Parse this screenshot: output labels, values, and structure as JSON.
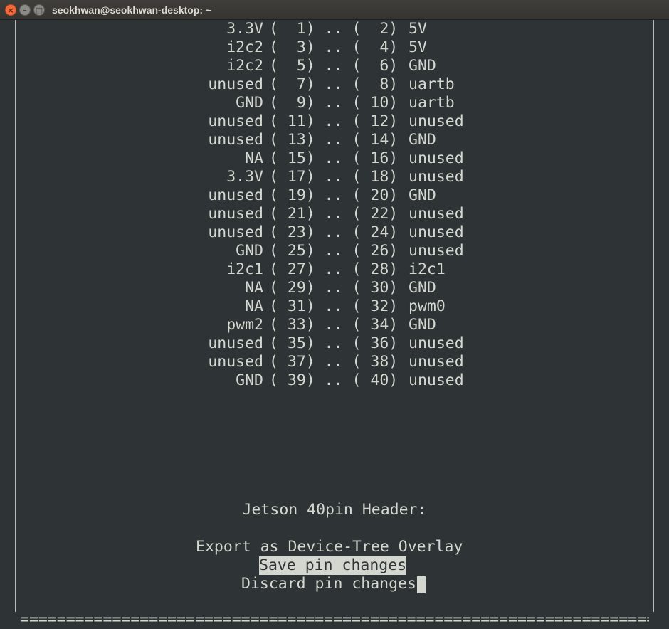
{
  "window": {
    "title": "seokhwan@seokhwan-desktop: ~",
    "close_symbol": "×",
    "minimize_symbol": "–",
    "maximize_symbol": "□"
  },
  "pins": [
    {
      "left": "3.3V",
      "pins": "(  1) .. (  2)",
      "right": "5V"
    },
    {
      "left": "i2c2",
      "pins": "(  3) .. (  4)",
      "right": "5V"
    },
    {
      "left": "i2c2",
      "pins": "(  5) .. (  6)",
      "right": "GND"
    },
    {
      "left": "unused",
      "pins": "(  7) .. (  8)",
      "right": "uartb"
    },
    {
      "left": "GND",
      "pins": "(  9) .. ( 10)",
      "right": "uartb"
    },
    {
      "left": "unused",
      "pins": "( 11) .. ( 12)",
      "right": "unused"
    },
    {
      "left": "unused",
      "pins": "( 13) .. ( 14)",
      "right": "GND"
    },
    {
      "left": "NA",
      "pins": "( 15) .. ( 16)",
      "right": "unused"
    },
    {
      "left": "3.3V",
      "pins": "( 17) .. ( 18)",
      "right": "unused"
    },
    {
      "left": "unused",
      "pins": "( 19) .. ( 20)",
      "right": "GND"
    },
    {
      "left": "unused",
      "pins": "( 21) .. ( 22)",
      "right": "unused"
    },
    {
      "left": "unused",
      "pins": "( 23) .. ( 24)",
      "right": "unused"
    },
    {
      "left": "GND",
      "pins": "( 25) .. ( 26)",
      "right": "unused"
    },
    {
      "left": "i2c1",
      "pins": "( 27) .. ( 28)",
      "right": "i2c1"
    },
    {
      "left": "NA",
      "pins": "( 29) .. ( 30)",
      "right": "GND"
    },
    {
      "left": "NA",
      "pins": "( 31) .. ( 32)",
      "right": "pwm0"
    },
    {
      "left": "pwm2",
      "pins": "( 33) .. ( 34)",
      "right": "GND"
    },
    {
      "left": "unused",
      "pins": "( 35) .. ( 36)",
      "right": "unused"
    },
    {
      "left": "unused",
      "pins": "( 37) .. ( 38)",
      "right": "unused"
    },
    {
      "left": "GND",
      "pins": "( 39) .. ( 40)",
      "right": "unused"
    }
  ],
  "menu": {
    "title": "Jetson 40pin Header:",
    "export_label": "Export as Device-Tree Overlay",
    "save_label": "Save pin changes",
    "discard_label": "Discard pin changes",
    "selected": "Save pin changes"
  },
  "bottom_rule": "===================================================================================",
  "colors": {
    "background": "#2e3436",
    "foreground": "#d3d7cf",
    "highlight_bg": "#d3d7cf",
    "highlight_fg": "#2e3436",
    "titlebar": "#3c3b37",
    "close_button": "#f46a3d"
  }
}
